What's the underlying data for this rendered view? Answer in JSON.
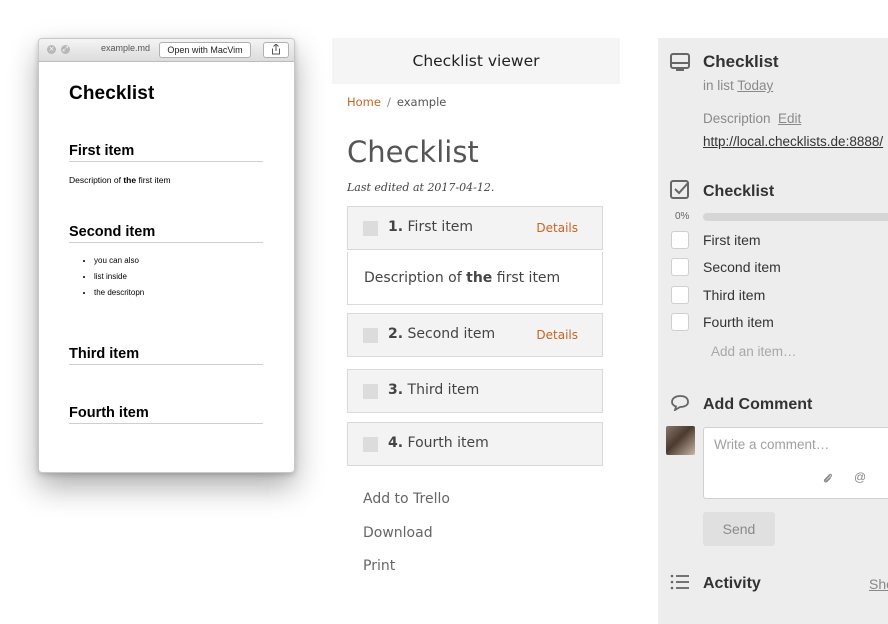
{
  "quicklook": {
    "filename": "example.md",
    "open_with_label": "Open with MacVim",
    "doc_title": "Checklist",
    "items": [
      {
        "heading": "First item"
      },
      {
        "heading": "Second item",
        "bullets": [
          "you can also",
          "list inside",
          "the descritopn"
        ]
      },
      {
        "heading": "Third item"
      },
      {
        "heading": "Fourth item"
      }
    ],
    "first_desc_pre": "Description of ",
    "first_desc_bold": "the",
    "first_desc_post": " first item"
  },
  "viewer": {
    "header": "Checklist viewer",
    "breadcrumb_home": "Home",
    "breadcrumb_sep": "/",
    "breadcrumb_current": "example",
    "title": "Checklist",
    "last_edited": "Last edited at 2017-04-12.",
    "items": [
      {
        "num": "1.",
        "label": "First item",
        "details": "Details"
      },
      {
        "num": "2.",
        "label": "Second item",
        "details": "Details"
      },
      {
        "num": "3.",
        "label": "Third item"
      },
      {
        "num": "4.",
        "label": "Fourth item"
      }
    ],
    "desc_pre": "Description of ",
    "desc_bold": "the",
    "desc_post": " first item",
    "actions": [
      "Add to Trello",
      "Download",
      "Print"
    ]
  },
  "trello": {
    "card_title": "Checklist",
    "in_list_prefix": "in list ",
    "list_name": "Today",
    "description_label": "Description",
    "edit_label": "Edit",
    "url": "http://local.checklists.de:8888/",
    "checklist_title": "Checklist",
    "progress_text": "0%",
    "progress": 0,
    "items": [
      "First item",
      "Second item",
      "Third item",
      "Fourth item"
    ],
    "add_item_placeholder": "Add an item…",
    "add_comment_title": "Add Comment",
    "comment_placeholder": "Write a comment…",
    "send_label": "Send",
    "activity_title": "Activity",
    "show_details": "Show Details"
  },
  "colors": {
    "accent_orange": "#c9631f",
    "trello_bg": "#ededed"
  }
}
